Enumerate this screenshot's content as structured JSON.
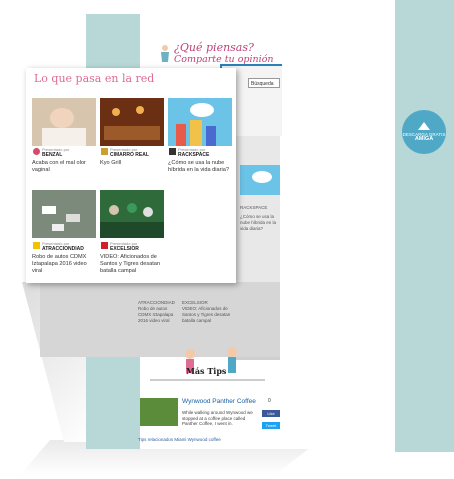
{
  "header": {
    "title": "¿Qué piensas?",
    "subtitle": "Comparte tu opinión",
    "search_select": "Búsqueda"
  },
  "badge": {
    "line1": "DESCARGA GRATIS",
    "line2": "AMIGA"
  },
  "card": {
    "title": "Lo que pasa en la red",
    "presented_by": "Presentado por",
    "tiles": [
      {
        "brand": "BENZAL",
        "caption": "Acaba con el mal olor vaginal",
        "thumb_color": "#c8b49c"
      },
      {
        "brand": "CIMARRO REAL",
        "caption": "Kyo Grill",
        "thumb_color": "#7a3a1a"
      },
      {
        "brand": "RACKSPACE",
        "caption": "¿Cómo se usa la nube híbrida en la vida diaria?",
        "thumb_color": "#6cc3e8"
      },
      {
        "brand": "ATRACCIONDIAD",
        "caption": "Robo de autos CDMX Iztapalapa 2016 video viral",
        "thumb_color": "#7a8a7a"
      },
      {
        "brand": "EXCELSIOR",
        "caption": "VIDEO: Aficionados de Santos y Tigres desatan batalla campal",
        "thumb_color": "#3a7a4a"
      }
    ]
  },
  "lower": {
    "tile1_brand": "ATRACCIONDIAD",
    "tile1_caption": "Robo de autos CDMX Iztapalapa 2016 video viral",
    "tile2_brand": "EXCELSIOR",
    "tile2_caption": "VIDEO: Aficionados de Santos y Tigres desatan batalla campal",
    "mas_tips": "Más Tips",
    "article_title": "Wynwood Panther Coffee",
    "article_body": "While walking around Wynwood we stopped at a coffee place called Panther Coffee, I went in.",
    "count": "0",
    "fb": "Like",
    "tw": "Tweet",
    "footer": "Tips relacionados   Miami   Wynwood coffee"
  },
  "right_panel": {
    "caption": "¿Cómo se usa la nube híbrida en la vida diaria?",
    "brand": "RACKSPACE"
  }
}
